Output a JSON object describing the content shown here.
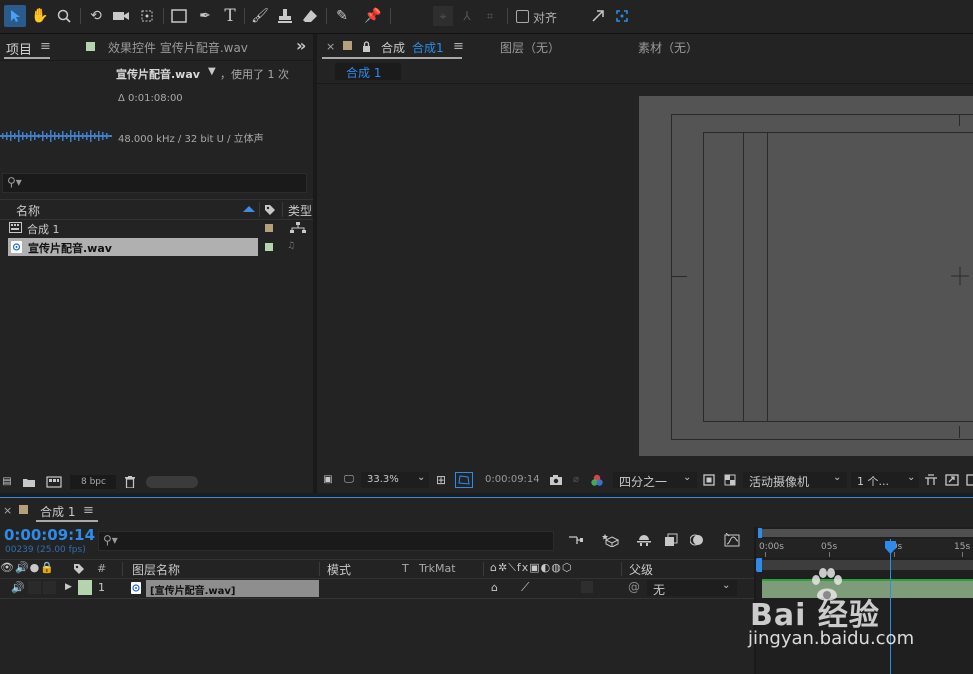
{
  "toolbar": {
    "snap_label": "对齐"
  },
  "project_panel": {
    "tab_label": "项目",
    "tab_menu": "≡",
    "effects_tab_label": "效果控件 宣传片配音.wav",
    "overflow": "»",
    "file_name": "宣传片配音.wav",
    "dropdown_arrow": "▼",
    "used_text": "，使用了 1 次",
    "duration": "Δ 0:01:08:00",
    "audio_info": "48.000 kHz / 32 bit U / 立体声",
    "search_icon": "search-icon",
    "col_name": "名称",
    "col_type": "类型",
    "items": [
      {
        "name": "合成 1",
        "color": "#b4a07c"
      },
      {
        "name": "宣传片配音.wav",
        "color": "#b6d3b0"
      }
    ],
    "bpc": "8 bpc"
  },
  "comp_panel": {
    "close": "×",
    "tab_label_prefix": "合成",
    "tab_label_name": "合成1",
    "tab_menu": "≡",
    "layer_tab": "图层（无）",
    "footage_tab": "素材（无）",
    "sub_tab": "合成 1",
    "zoom": "33.3%",
    "timecode": "0:00:09:14",
    "resolution": "四分之一",
    "camera": "活动摄像机",
    "views": "1 个..."
  },
  "timeline": {
    "close": "×",
    "tab_label": "合成 1",
    "tab_menu": "≡",
    "current_time": "0:00:09:14",
    "frame_info": "00239 (25.00 fps)",
    "col_num": "#",
    "col_layer_name": "图层名称",
    "col_mode": "模式",
    "col_t": "T",
    "col_trkmat": "TrkMat",
    "col_parent": "父级",
    "ruler_labels": [
      "0:00s",
      "05s",
      "10s",
      "15s"
    ],
    "layers": [
      {
        "index": "1",
        "name": "[宣传片配音.wav]",
        "parent": "无",
        "color": "#b6d3b0"
      }
    ],
    "accent_color": "#2d8ceb"
  },
  "watermark": {
    "brand": "Bai 经验",
    "url": "jingyan.baidu.com"
  }
}
